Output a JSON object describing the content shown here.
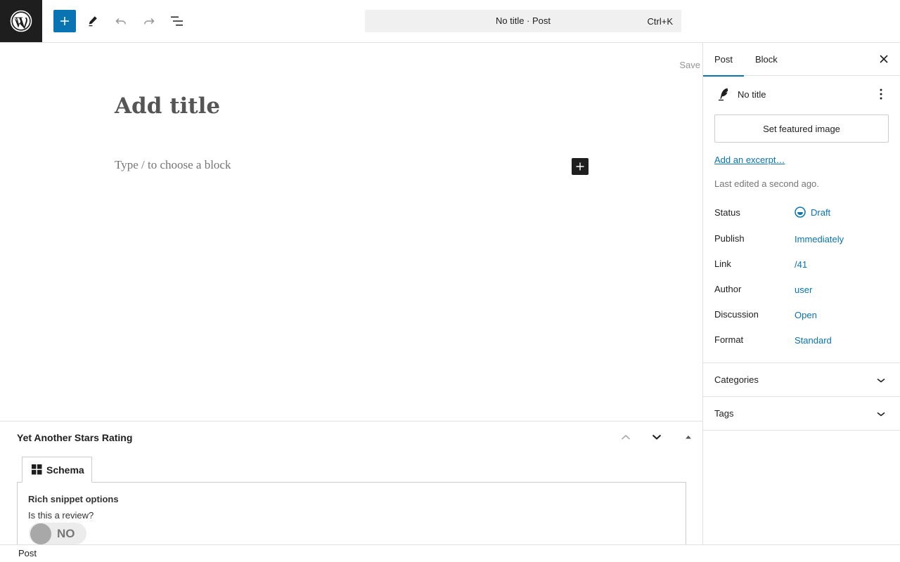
{
  "topbar": {
    "logo": "wordpress-logo",
    "icons": [
      "plus-icon",
      "pencil-icon",
      "undo-icon",
      "redo-icon",
      "list-view-icon"
    ],
    "document_title": "No title · Post",
    "shortcut": "Ctrl+K",
    "accent": "#0a73b1"
  },
  "editor": {
    "save_label": "Save",
    "title_placeholder": "Add title",
    "block_placeholder": "Type / to choose a block"
  },
  "metabox": {
    "title": "Yet Another Stars Rating",
    "tab_label": "Schema",
    "section_title": "Rich snippet options",
    "question": "Is this a review?",
    "toggle_label": "NO",
    "toggle_on": false
  },
  "footer": {
    "breadcrumb": "Post"
  },
  "sidebar": {
    "tabs": [
      "Post",
      "Block"
    ],
    "active_tab": "Post",
    "summary_title": "No title",
    "featured_button": "Set featured image",
    "excerpt_link": "Add an excerpt…",
    "last_edited": "Last edited a second ago.",
    "rows": [
      {
        "label": "Status",
        "value": "Draft"
      },
      {
        "label": "Publish",
        "value": "Immediately"
      },
      {
        "label": "Link",
        "value": "/41"
      },
      {
        "label": "Author",
        "value": "user"
      },
      {
        "label": "Discussion",
        "value": "Open"
      },
      {
        "label": "Format",
        "value": "Standard"
      }
    ],
    "panels": [
      "Categories",
      "Tags"
    ]
  }
}
